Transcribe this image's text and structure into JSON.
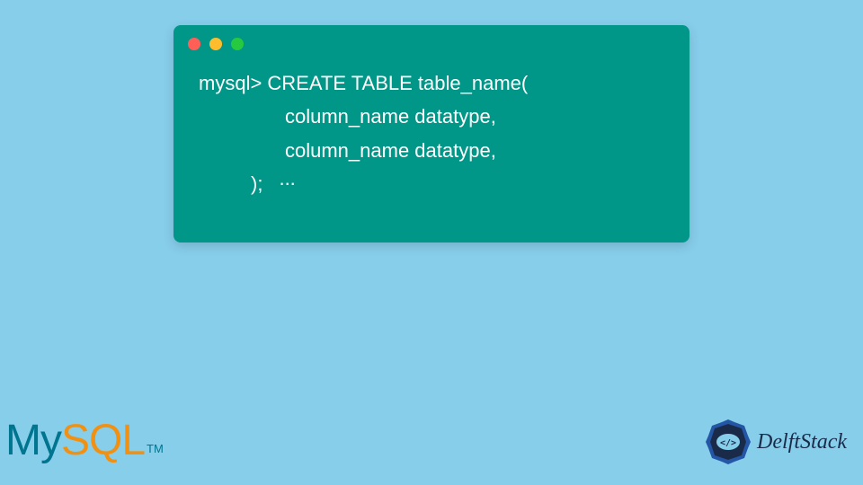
{
  "terminal": {
    "lines": {
      "l1": "mysql> CREATE TABLE table_name(",
      "l2": "column_name datatype,",
      "l3": "column_name datatype,",
      "l4_close": ");",
      "l4_ellipsis": "..."
    }
  },
  "logos": {
    "mysql": {
      "my": "My",
      "sql": "SQL",
      "tm": "TM"
    },
    "delftstack": {
      "text": "DelftStack",
      "icon_code": "</>"
    }
  },
  "colors": {
    "background": "#87ceeb",
    "terminal_bg": "#009688",
    "mysql_teal": "#00758f",
    "mysql_orange": "#f29111",
    "delft_navy": "#1a2b4a",
    "delft_accent": "#2456a6"
  }
}
